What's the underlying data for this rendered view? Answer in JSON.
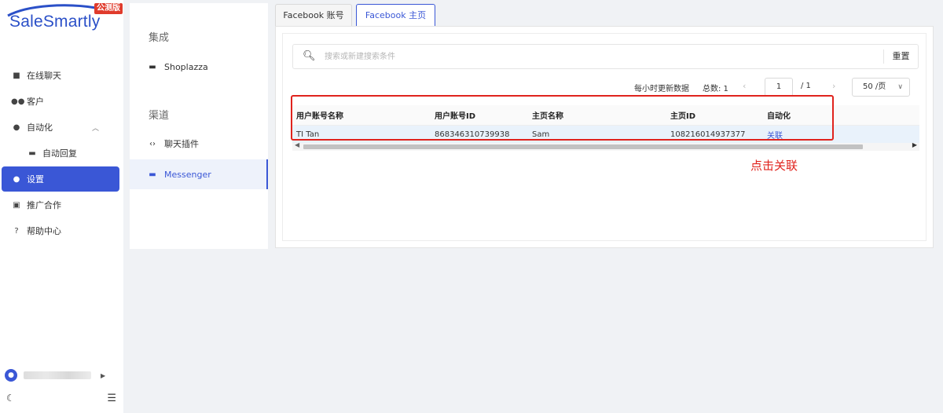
{
  "sidebar": {
    "logo_text": "SaleSmartly",
    "logo_badge": "公测版",
    "items": [
      {
        "label": "在线聊天",
        "icon": "chat-icon"
      },
      {
        "label": "客户",
        "icon": "customers-icon"
      },
      {
        "label": "自动化",
        "icon": "automation-icon"
      },
      {
        "label": "自动回复",
        "icon": "auto-reply-icon"
      },
      {
        "label": "设置",
        "icon": "settings-icon"
      },
      {
        "label": "推广合作",
        "icon": "promotion-icon"
      },
      {
        "label": "帮助中心",
        "icon": "help-icon"
      }
    ]
  },
  "middle": {
    "section1": "集成",
    "shoplazza": "Shoplazza",
    "section2": "渠道",
    "chat_plugin": "聊天插件",
    "messenger": "Messenger"
  },
  "tabs": [
    {
      "label": "Facebook 账号"
    },
    {
      "label": "Facebook 主页"
    }
  ],
  "search": {
    "placeholder": "搜索或新建搜索条件",
    "reset_label": "重置"
  },
  "pager": {
    "update_note": "每小时更新数据",
    "total_label": "总数: 1",
    "current_page": "1",
    "total_pages": "/ 1",
    "page_size": "50 /页"
  },
  "table": {
    "headers": [
      "用户账号名称",
      "用户账号ID",
      "主页名称",
      "主页ID",
      "自动化"
    ],
    "rows": [
      [
        "TI Tan",
        "868346310739938",
        "Sam",
        "108216014937377",
        "关联"
      ]
    ]
  },
  "annotation": "点击关联",
  "colors": {
    "accent": "#3a57d6",
    "highlight_red": "#e0231d",
    "badge_red": "#e03b2c"
  }
}
